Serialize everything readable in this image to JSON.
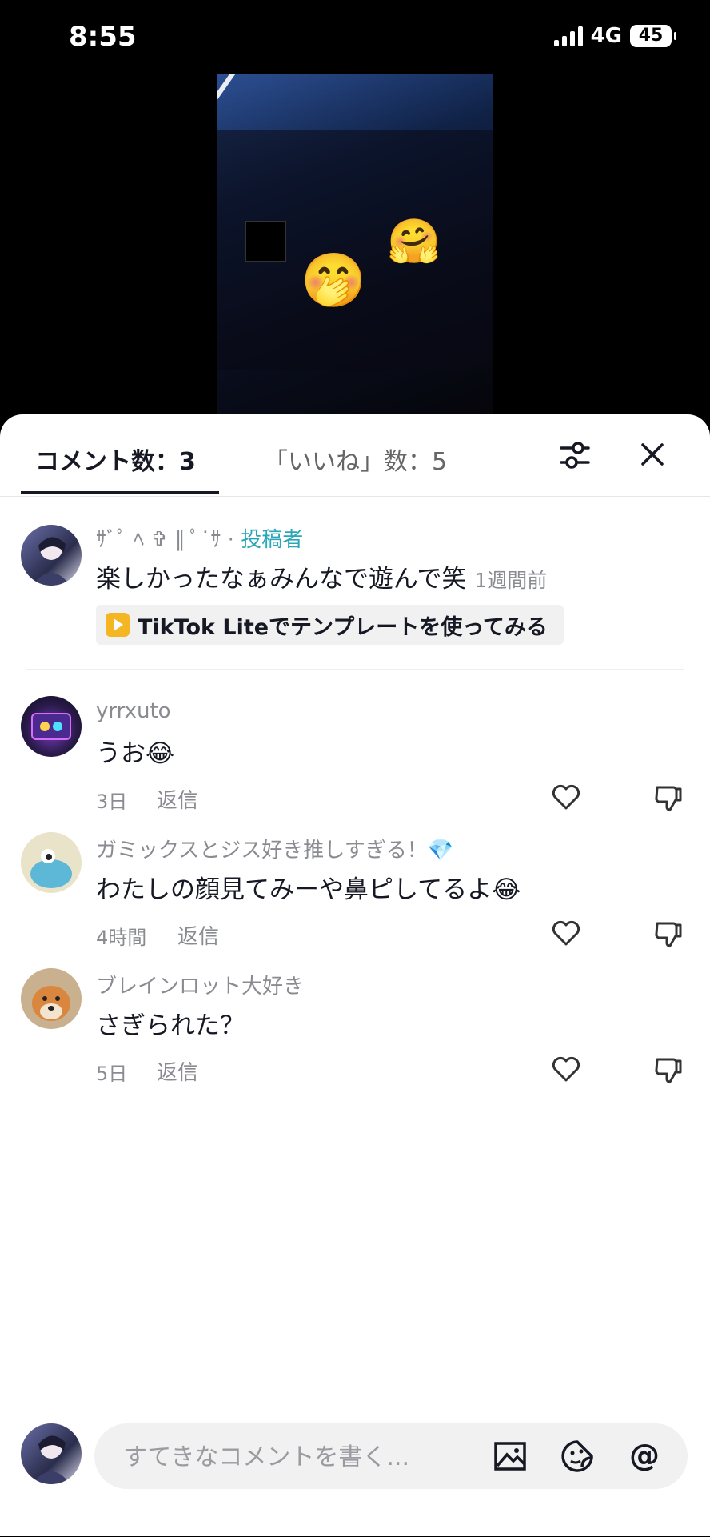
{
  "status_bar": {
    "time": "8:55",
    "network": "4G",
    "battery": "45"
  },
  "video": {
    "emojis": [
      "🤗",
      "🤭"
    ]
  },
  "tabs": {
    "comments": "コメント数：3",
    "likes": "「いいね」数：5"
  },
  "post": {
    "author_name": "ｻﾞﾟ ﾍ ✞ ∥ ﾟ˙ｻ ·",
    "author_badge": "投稿者",
    "text": "楽しかったなぁみんなで遊んで笑",
    "time": "1週間前",
    "template_cta": "TikTok Liteでテンプレートを使ってみる"
  },
  "comments": [
    {
      "name": "yrrxuto",
      "text": "うお😂",
      "time": "3日",
      "reply": "返信"
    },
    {
      "name": "ガミックスとジス好き推しすぎる！💎",
      "text": "わたしの顔見てみーや鼻ピしてるよ😂",
      "time": "4時間",
      "reply": "返信"
    },
    {
      "name": "ブレインロット大好き",
      "text": "さぎられた？",
      "time": "5日",
      "reply": "返信"
    }
  ],
  "composer": {
    "placeholder": "すてきなコメントを書く..."
  }
}
